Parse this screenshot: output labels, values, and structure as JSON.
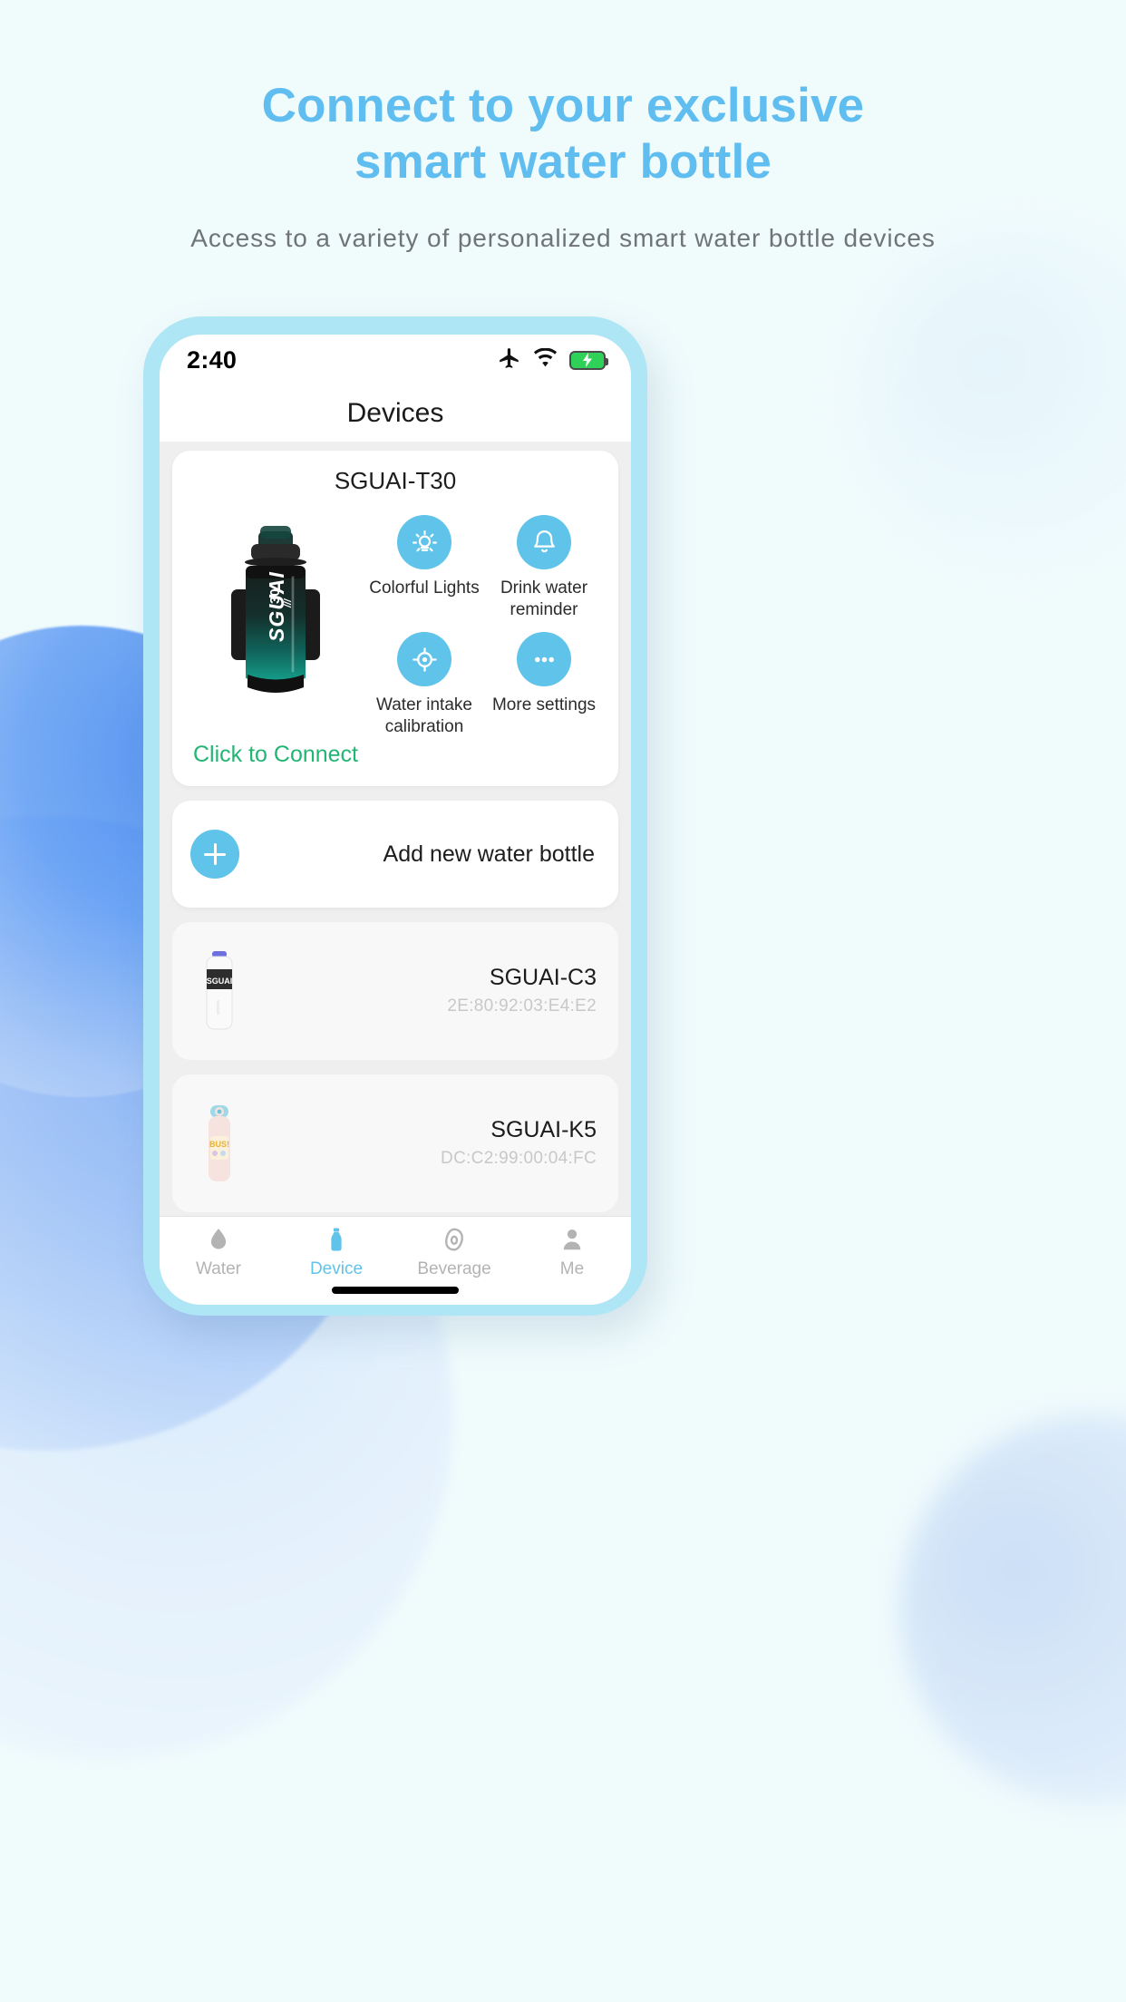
{
  "page": {
    "headline_line1": "Connect to your exclusive",
    "headline_line2": "smart water bottle",
    "subheadline": "Access to a variety of personalized smart water bottle devices",
    "headline_color": "#60bdef",
    "subheadline_color": "#6f7478",
    "background_color": "#f0fbfc"
  },
  "phone": {
    "frame_color": "#aee6f6",
    "status_bar": {
      "time": "2:40",
      "icons": [
        "airplane-mode-icon",
        "wifi-icon",
        "battery-charging-icon"
      ],
      "battery_color": "#2fd158"
    },
    "nav_title": "Devices"
  },
  "device_card": {
    "name": "SGUAI-T30",
    "product_image_alt": "sguai-t30-bottle",
    "bottle_brand": "SGUAI",
    "bottle_model": "T30",
    "connect_label": "Click to Connect",
    "connect_color": "#22b573",
    "accent_color": "#5fc3ea",
    "features": [
      {
        "label": "Colorful Lights",
        "icon": "lightbulb-icon"
      },
      {
        "label": "Drink water reminder",
        "icon": "bell-icon"
      },
      {
        "label": "Water intake calibration",
        "icon": "target-icon"
      },
      {
        "label": "More settings",
        "icon": "ellipsis-icon"
      }
    ]
  },
  "add_row": {
    "label": "Add new water bottle",
    "icon": "plus-icon"
  },
  "devices": [
    {
      "name": "SGUAI-C3",
      "mac": "2E:80:92:03:E4:E2",
      "thumb": "white-bottle-thumb"
    },
    {
      "name": "SGUAI-K5",
      "mac": "DC:C2:99:00:04:FC",
      "thumb": "pink-bottle-thumb"
    }
  ],
  "tabbar": {
    "items": [
      {
        "label": "Water",
        "icon": "water-drop-icon",
        "active": false
      },
      {
        "label": "Device",
        "icon": "bottle-icon",
        "active": true
      },
      {
        "label": "Beverage",
        "icon": "beverage-icon",
        "active": false
      },
      {
        "label": "Me",
        "icon": "person-icon",
        "active": false
      }
    ],
    "active_color": "#5fc3ea",
    "inactive_color": "#b3b3b3"
  }
}
